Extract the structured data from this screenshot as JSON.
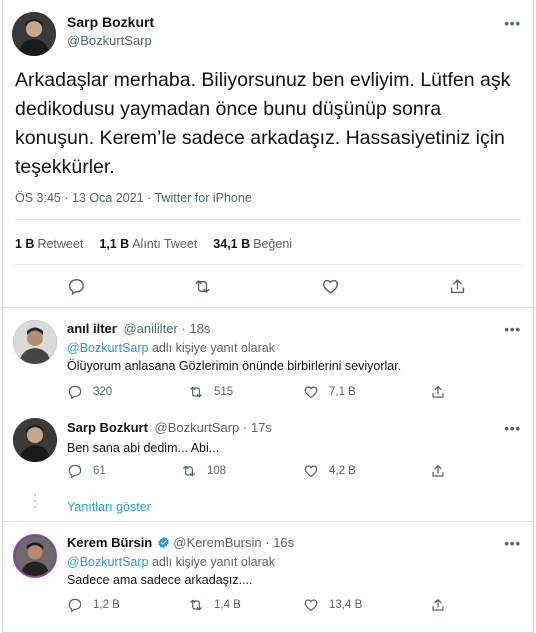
{
  "main_tweet": {
    "author_name": "Sarp Bozkurt",
    "author_handle": "@BozkurtSarp",
    "text": "Arkadaşlar merhaba. Biliyorsunuz ben evliyim. Lütfen aşk dedikodusu yaymadan önce bunu düşünüp sonra konuşun. Kerem’le sadece arkadaşız. Hassasiyetiniz için teşekkürler.",
    "time": "ÖS 3:45",
    "date": "13 Oca 2021",
    "source": "Twitter for iPhone",
    "separator": "·",
    "stats": [
      {
        "value": "1 B",
        "label": "Retweet"
      },
      {
        "value": "1,1 B",
        "label": "Alıntı Tweet"
      },
      {
        "value": "34,1 B",
        "label": "Beğeni"
      }
    ],
    "more_label": "•••"
  },
  "replies": [
    {
      "author_name": "anıl ilter",
      "author_handle": "@anililter",
      "time": "18s",
      "reply_to_handle": "@BozkurtSarp",
      "reply_to_suffix": "adlı kişiye yanıt olarak",
      "text": "Ölüyorum anlasana Gözlerimin önünde birbirlerini seviyorlar.",
      "reply_count": "320",
      "retweet_count": "515",
      "like_count": "7,1 B"
    },
    {
      "author_name": "Sarp Bozkurt",
      "author_handle": "@BozkurtSarp",
      "time": "17s",
      "text": "Ben sana abi dedim... Abi...",
      "reply_count": "61",
      "retweet_count": "108",
      "like_count": "4,2 B"
    },
    {
      "author_name": "Kerem Bürsin",
      "author_handle": "@KeremBursin",
      "time": "16s",
      "verified": true,
      "reply_to_handle": "@BozkurtSarp",
      "reply_to_suffix": "adlı kişiye yanıt olarak",
      "text": "Sadece ama sadece arkadaşız....",
      "reply_count": "1,2 B",
      "retweet_count": "1,4 B",
      "like_count": "13,4 B"
    }
  ],
  "show_replies_label": "Yanıtları göster",
  "colors": {
    "text": "#0f1419",
    "secondary": "#536471",
    "link": "#1d9bf0",
    "border": "#cfd9de"
  },
  "icons": [
    "reply-icon",
    "retweet-icon",
    "like-icon",
    "share-icon",
    "verified-badge-icon",
    "more-icon"
  ]
}
